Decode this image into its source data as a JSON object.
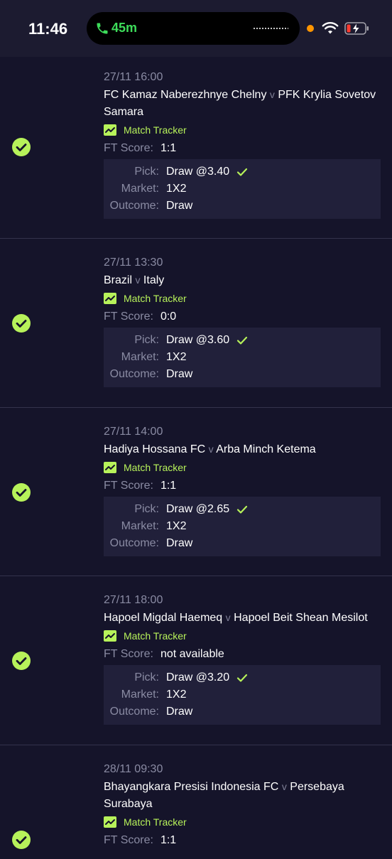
{
  "status_bar": {
    "time": "11:46",
    "call_duration": "45m"
  },
  "colors": {
    "accent": "#b7f25a",
    "background": "#15142a",
    "panel": "#21203a",
    "muted_text": "#8a8ba3"
  },
  "labels": {
    "vs": "v",
    "match_tracker": "Match Tracker",
    "ft_score": "FT Score:",
    "pick": "Pick:",
    "market": "Market:",
    "outcome": "Outcome:"
  },
  "bets": [
    {
      "date": "27/11 16:00",
      "home": "FC Kamaz Naberezhnye Chelny",
      "away": "PFK Krylia Sovetov Samara",
      "ft_score": "1:1",
      "pick": "Draw @3.40",
      "market": "1X2",
      "outcome": "Draw",
      "status": "won"
    },
    {
      "date": "27/11 13:30",
      "home": "Brazil",
      "away": "Italy",
      "ft_score": "0:0",
      "pick": "Draw @3.60",
      "market": "1X2",
      "outcome": "Draw",
      "status": "won"
    },
    {
      "date": "27/11 14:00",
      "home": "Hadiya Hossana FC",
      "away": "Arba Minch Ketema",
      "ft_score": "1:1",
      "pick": "Draw @2.65",
      "market": "1X2",
      "outcome": "Draw",
      "status": "won"
    },
    {
      "date": "27/11 18:00",
      "home": "Hapoel Migdal Haemeq",
      "away": "Hapoel Beit Shean Mesilot",
      "ft_score": "not available",
      "pick": "Draw @3.20",
      "market": "1X2",
      "outcome": "Draw",
      "status": "won"
    },
    {
      "date": "28/11 09:30",
      "home": "Bhayangkara Presisi Indonesia FC",
      "away": "Persebaya Surabaya",
      "ft_score": "1:1",
      "status": "won"
    }
  ]
}
